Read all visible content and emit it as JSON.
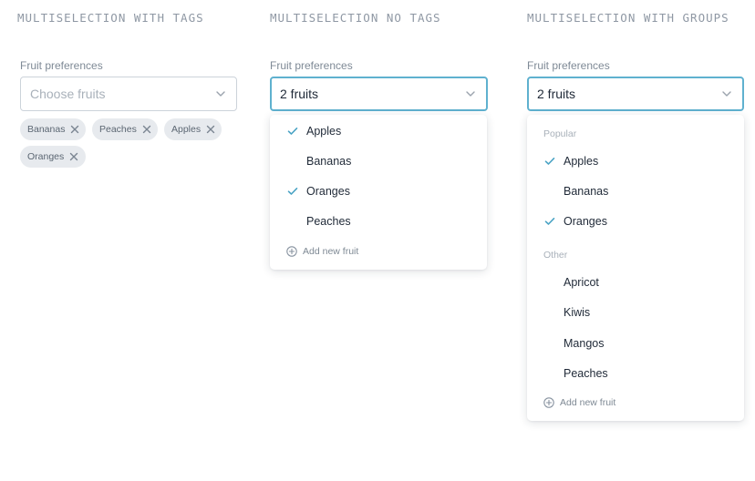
{
  "sections": {
    "tags": {
      "title": "MULTISELECTION WITH TAGS",
      "label": "Fruit preferences",
      "placeholder": "Choose fruits",
      "tags": [
        "Bananas",
        "Peaches",
        "Apples",
        "Oranges"
      ]
    },
    "no_tags": {
      "title": "MULTISELECTION NO TAGS",
      "label": "Fruit preferences",
      "value": "2 fruits",
      "options": [
        {
          "label": "Apples",
          "checked": true
        },
        {
          "label": "Bananas",
          "checked": false
        },
        {
          "label": "Oranges",
          "checked": true
        },
        {
          "label": "Peaches",
          "checked": false
        }
      ],
      "add_new": "Add new fruit"
    },
    "groups": {
      "title": "MULTISELECTION WITH GROUPS",
      "label": "Fruit preferences",
      "value": "2 fruits",
      "groups": [
        {
          "name": "Popular",
          "options": [
            {
              "label": "Apples",
              "checked": true
            },
            {
              "label": "Bananas",
              "checked": false
            },
            {
              "label": "Oranges",
              "checked": true
            }
          ]
        },
        {
          "name": "Other",
          "options": [
            {
              "label": "Apricot",
              "checked": false
            },
            {
              "label": "Kiwis",
              "checked": false
            },
            {
              "label": "Mangos",
              "checked": false
            },
            {
              "label": "Peaches",
              "checked": false
            }
          ]
        }
      ],
      "add_new": "Add new fruit"
    }
  },
  "colors": {
    "accent": "#5fb1cf",
    "check": "#4aa3c4",
    "tag_bg": "#e7eaee",
    "border": "#ccd3da"
  },
  "icons": {
    "chevron": "chevron-down-icon",
    "tag_remove": "close-icon",
    "check": "check-icon",
    "add": "plus-circle-icon"
  }
}
